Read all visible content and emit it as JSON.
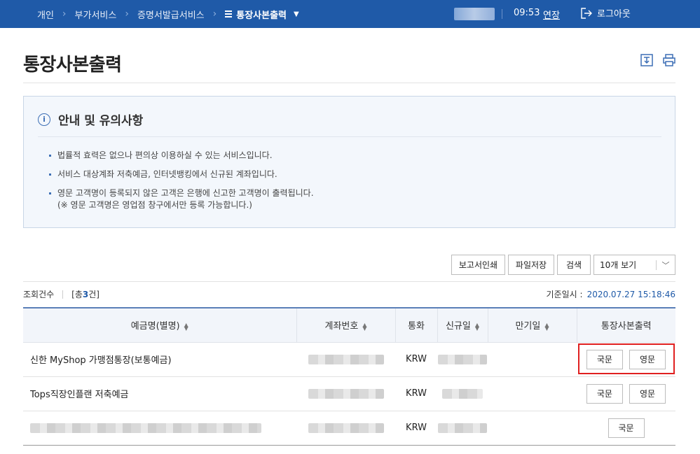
{
  "topbar": {
    "breadcrumbs": [
      "개인",
      "부가서비스",
      "증명서발급서비스"
    ],
    "current": "통장사본출력",
    "time": "09:53",
    "extend_label": "연장",
    "logout_label": "로그아웃"
  },
  "page": {
    "title": "통장사본출력"
  },
  "notice": {
    "title": "안내 및 유의사항",
    "items": [
      "법률적 효력은 없으나 편의상 이용하실 수 있는 서비스입니다.",
      "서비스 대상계좌 저축예금, 인터넷뱅킹에서 신규된 계좌입니다.",
      "영문 고객명이 등록되지 않은 고객은 은행에 신고한 고객명이 출력됩니다."
    ],
    "item3_sub": "(※ 영문 고객명은 영업점 창구에서만 등록 가능합니다.)"
  },
  "actions": {
    "print_report": "보고서인쇄",
    "save_file": "파일저장",
    "search": "검색",
    "page_size": "10개 보기"
  },
  "summary": {
    "label": "조회건수",
    "count_prefix": "[총 ",
    "count": "3",
    "count_suffix": "건]",
    "base_label": "기준일시 :",
    "base_datetime": "2020.07.27 15:18:46"
  },
  "table": {
    "headers": [
      "예금명(별명)",
      "계좌번호",
      "통화",
      "신규일",
      "만기일",
      "통장사본출력"
    ],
    "rows": [
      {
        "name": "신한 MyShop 가맹점통장(보통예금)",
        "currency": "KRW",
        "btn_kr": "국문",
        "btn_en": "영문"
      },
      {
        "name": "Tops직장인플랜 저축예금",
        "currency": "KRW",
        "btn_kr": "국문",
        "btn_en": "영문"
      },
      {
        "name": "",
        "currency": "KRW",
        "btn_kr": "국문"
      }
    ]
  },
  "colors": {
    "topbar": "#1f5aa8",
    "accent": "#1f5aa8",
    "highlight": "#e02020"
  }
}
